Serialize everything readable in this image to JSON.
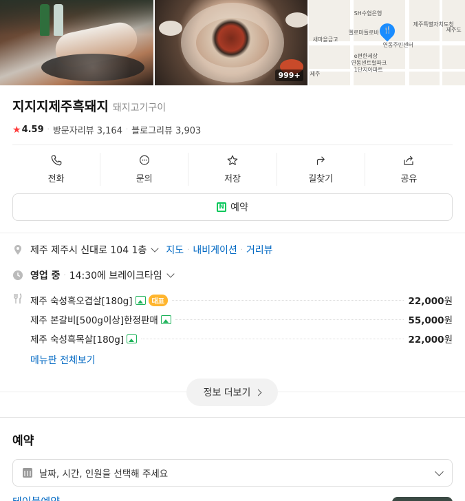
{
  "gallery": {
    "photo_count_badge": "999+",
    "map_labels": [
      "SH수협은행",
      "제주특별자치도청",
      "제주도",
      "멜로마들로바",
      "새마을금고",
      "연동주민센터",
      "e편한세상",
      "연동센트럴파크",
      "1단지아파트",
      "제주"
    ]
  },
  "place": {
    "name": "지지지제주흑돼지",
    "category": "돼지고기구이",
    "rating": "4.59",
    "visitor_reviews": "방문자리뷰 3,164",
    "blog_reviews": "블로그리뷰 3,903"
  },
  "actions": [
    {
      "label": "전화",
      "icon": "phone-icon"
    },
    {
      "label": "문의",
      "icon": "chat-icon"
    },
    {
      "label": "저장",
      "icon": "star-icon"
    },
    {
      "label": "길찾기",
      "icon": "directions-icon"
    },
    {
      "label": "공유",
      "icon": "share-icon"
    }
  ],
  "reserve_button": "예약",
  "address": {
    "text": "제주 제주시 신대로 104 1층",
    "links": [
      "지도",
      "내비게이션",
      "거리뷰"
    ]
  },
  "hours": {
    "status": "영업 중",
    "detail": "14:30에 브레이크타임"
  },
  "menu": {
    "items": [
      {
        "name": "제주 숙성흑오겹살[180g]",
        "badge": "대표",
        "price": "22,000",
        "unit": "원"
      },
      {
        "name": "제주 본갈비[500g이상]한정판매",
        "badge": "",
        "price": "55,000",
        "unit": "원"
      },
      {
        "name": "제주 숙성흑목살[180g]",
        "badge": "",
        "price": "22,000",
        "unit": "원"
      }
    ],
    "view_all": "메뉴판 전체보기"
  },
  "more_info": "정보 더보기",
  "reservation": {
    "title": "예약",
    "placeholder": "날짜, 시간, 인원을 선택해 주세요",
    "cut_link": "테이블예약"
  },
  "colors": {
    "link": "#0068c3",
    "star": "#ff3a3a",
    "naver_green": "#03c75a",
    "badge": "#ffb52e"
  }
}
